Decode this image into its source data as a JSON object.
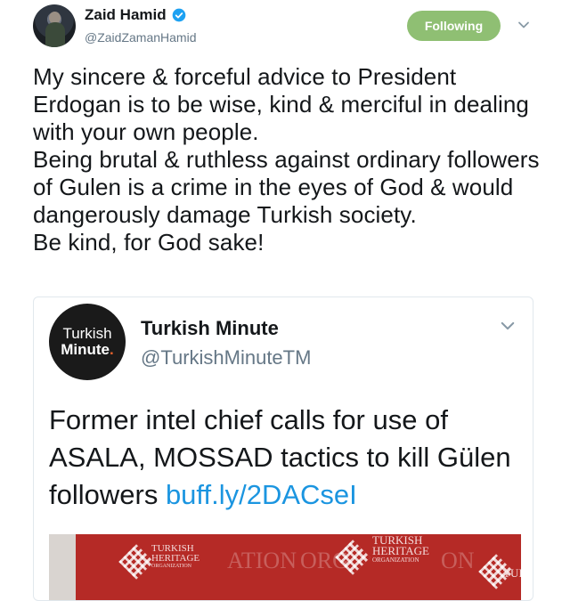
{
  "tweet": {
    "author_name": "Zaid Hamid",
    "author_handle": "@ZaidZamanHamid",
    "follow_label": "Following",
    "text_paragraphs": [
      "My sincere & forceful advice to President Erdogan is to be wise, kind & merciful in dealing with your own people.",
      "Being brutal & ruthless against ordinary followers of Gulen is a crime in the eyes of God & would dangerously damage Turkish society.",
      "Be kind, for God sake!"
    ]
  },
  "quoted": {
    "avatar_line1": "Turkish",
    "avatar_line2": "Minute",
    "avatar_dot": ".",
    "name": "Turkish Minute",
    "handle": "@TurkishMinuteTM",
    "text": "Former intel chief calls for use of ASALA, MOSSAD tactics to kill Gülen followers ",
    "link": "buff.ly/2DACseI",
    "image_banner_text_1": "TURKISH HERITAGE",
    "image_banner_sub_1": "ORGANIZATION",
    "image_banner_text_2": "TURKISH HERITAGE",
    "image_banner_sub_2": "ORGANIZATION",
    "image_bg_fragment_1": "ATION",
    "image_bg_fragment_2": "ORG",
    "image_bg_fragment_3": "ON",
    "image_bg_fragment_4": "TUI"
  },
  "colors": {
    "following_button": "#8fbf73",
    "verified_badge": "#1da1f2",
    "link": "#1b95e0",
    "handle": "#657786"
  },
  "icons": {
    "verified": "verified-badge-icon",
    "caret": "chevron-down-icon"
  }
}
